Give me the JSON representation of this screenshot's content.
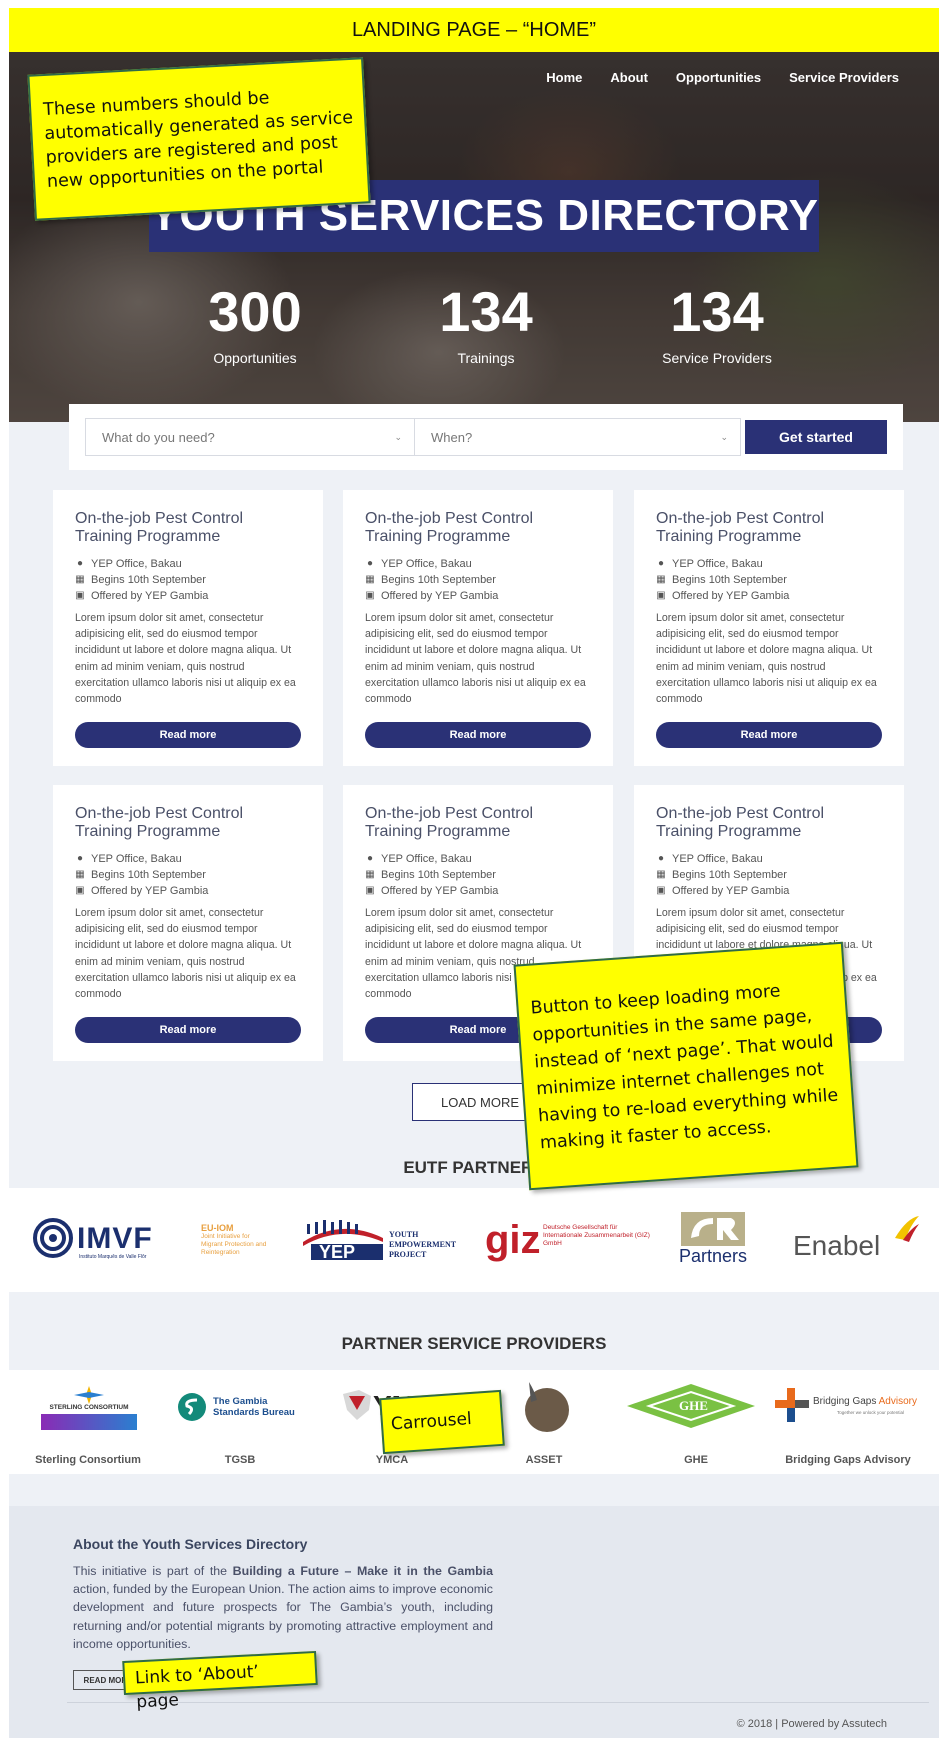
{
  "banner": "LANDING PAGE – “HOME”",
  "nav": [
    "Home",
    "About",
    "Opportunities",
    "Service Providers"
  ],
  "hero_title": "YOUTH SERVICES DIRECTORY",
  "stats": [
    {
      "num": "300",
      "label": "Opportunities"
    },
    {
      "num": "134",
      "label": "Trainings"
    },
    {
      "num": "134",
      "label": "Service Providers"
    }
  ],
  "search": {
    "what": "What do you need?",
    "when": "When?",
    "button": "Get started"
  },
  "card": {
    "title": "On-the-job Pest Control Training Programme",
    "location": "YEP Office, Bakau",
    "date": "Begins 10th September",
    "offered": "Offered by YEP Gambia",
    "desc": "Lorem ipsum dolor sit amet, consectetur adipisicing elit, sed do eiusmod tempor incididunt ut labore et dolore magna aliqua. Ut enim ad minim veniam, quis nostrud exercitation ullamco laboris nisi ut aliquip ex ea commodo",
    "button": "Read more"
  },
  "load_more": "LOAD MORE",
  "eutf_heading": "EUTF PARTNERS",
  "eutf_logos": {
    "imvf": "IMVF",
    "imvf_sub": "Instituto Marquês de Valle Flôr",
    "euiom": "EU-IOM",
    "euiom_sub": "Joint Initiative for Migrant Protection and Reintegration",
    "yep": "YEP",
    "yep_sub": "YOUTH EMPOWERMENT PROJECT",
    "giz": "giz",
    "giz_sub": "Deutsche Gesellschaft für Internationale Zusammenarbeit (GIZ) GmbH",
    "gr": "Partners",
    "enabel": "Enabel"
  },
  "providers_heading": "PARTNER SERVICE PROVIDERS",
  "providers": [
    "Sterling Consortium",
    "TGSB",
    "YMCA",
    "ASSET",
    "GHE",
    "Bridging Gaps Advisory"
  ],
  "provider_logos": {
    "sterling": "STERLING CONSORTIUM",
    "tgsb": "The Gambia Standards Bureau",
    "ymca": "YMCA",
    "ghe": "GHE",
    "bga": "Bridging Gaps",
    "bga_accent": "Advisory",
    "bga_sub": "Together we unlock your potential"
  },
  "about": {
    "title": "About the Youth Services Directory",
    "text_pre": "This initiative is part of the ",
    "text_bold": "Building a Future – Make it in the Gambia",
    "text_post": " action, funded by the European Union. The action aims to improve economic development and future prospects for The Gambia’s youth, including returning and/or potential migrants by promoting attractive employment and income opportunities.",
    "button": "READ MORE"
  },
  "copyright": "© 2018 | Powered by Assutech",
  "notes": {
    "numbers": "These numbers should be automatically generated as service providers are registered and post new opportunities on the portal",
    "load": "Button to keep loading more opportunities in the same page, instead of ‘next page’. That would minimize internet challenges not having to re-load everything while making it faster to access.",
    "carousel": "Carrousel",
    "about": "Link to ‘About’ page"
  },
  "colors": {
    "navy": "#2a3176",
    "note": "#ffff00",
    "page_bg": "#eef1f6"
  }
}
